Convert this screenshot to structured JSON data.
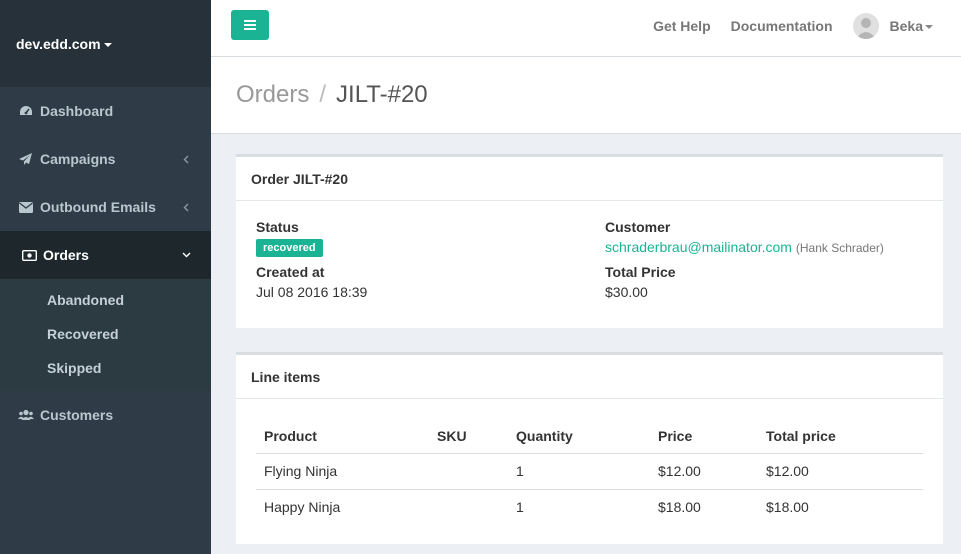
{
  "sidebar": {
    "brand": "dev.edd.com",
    "items": [
      {
        "label": "Dashboard",
        "icon": "dashboard-icon"
      },
      {
        "label": "Campaigns",
        "icon": "paper-plane-icon"
      },
      {
        "label": "Outbound Emails",
        "icon": "envelope-icon"
      },
      {
        "label": "Orders",
        "icon": "money-icon"
      },
      {
        "label": "Customers",
        "icon": "users-icon"
      }
    ],
    "orders_submenu": [
      "Abandoned",
      "Recovered",
      "Skipped"
    ]
  },
  "header": {
    "toggle_icon": "hamburger-icon",
    "help": "Get Help",
    "docs": "Documentation",
    "user": "Beka"
  },
  "breadcrumb": {
    "parent": "Orders",
    "separator": "/",
    "current": "JILT-#20"
  },
  "order": {
    "title": "Order JILT-#20",
    "status_label": "Status",
    "status": "recovered",
    "created_label": "Created at",
    "created": "Jul 08 2016 18:39",
    "customer_label": "Customer",
    "customer_email": "schraderbrau@mailinator.com",
    "customer_name": "(Hank Schrader)",
    "total_label": "Total Price",
    "total": "$30.00"
  },
  "line_items": {
    "title": "Line items",
    "columns": [
      "Product",
      "SKU",
      "Quantity",
      "Price",
      "Total price"
    ],
    "rows": [
      [
        "Flying Ninja",
        "",
        "1",
        "$12.00",
        "$12.00"
      ],
      [
        "Happy Ninja",
        "",
        "1",
        "$18.00",
        "$18.00"
      ]
    ]
  },
  "colors": {
    "accent": "#1ab394",
    "sidebar": "#2f3c47"
  }
}
